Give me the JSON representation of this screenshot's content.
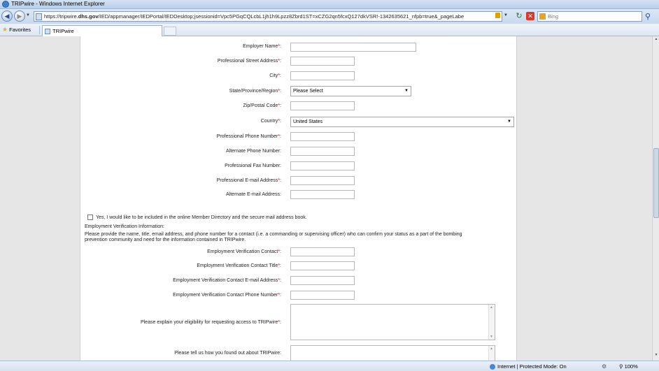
{
  "window": {
    "title": "TRIPwire - Windows Internet Explorer"
  },
  "address_bar": {
    "url_prefix": "https://tripwire.",
    "url_domain": "dhs.gov",
    "url_rest": "/IED/appmanager/IEDPortal/IEDDesktop;jsessionid=Vpc5PGqCQLcbL1jh1h9Lpzz8Zbrd1ST=xCZG2qn5fcxQ127dkVSR!-1342635621_nfpb=true&_pageLabel=USER_REGISTRATION&userAc",
    "search_placeholder": "Bing"
  },
  "favorites_bar": {
    "favorites_label": "Favorites",
    "tab_label": "TRIPwire"
  },
  "form": {
    "employer_name_label": "Employer Name",
    "street_label": "Professional Street Address",
    "city_label": "City",
    "state_label": "State/Province/Region",
    "state_value": "Please Select",
    "zip_label": "Zip/Postal Code",
    "country_label": "Country",
    "country_value": "United States",
    "phone_label": "Professional Phone Number",
    "alt_phone_label": "Alternate Phone Number:",
    "fax_label": "Professional Fax Number:",
    "email_label": "Professional E-mail Address",
    "alt_email_label": "Alternate E-mail Address:",
    "required_mark": "*",
    "colon": ":",
    "directory_checkbox_label": "Yes, I would like to be included in the online Member Directory and the secure mail address book.",
    "verification_heading": "Employment Verification Information:",
    "verification_text_line1": "Please provide the name, title, email address, and phone number for a contact (i.e. a commanding or supervising officer) who can confirm your status as a part of the bombing",
    "verification_text_line2": "prevention community and need for the information contained in TRIPwire.",
    "ev_contact_label": "Employment Verification Contact",
    "ev_title_label": "Employment Verification Contact Title",
    "ev_email_label": "Employment Verification Contact E-mail Address",
    "ev_phone_label": "Employment Verification Contact Phone Number",
    "eligibility_label": "Please explain your eligibility for requesting access to TRIPwire",
    "found_out_label": "Please tell us how you found out about TRIPwire:"
  },
  "status_bar": {
    "zone": "Internet | Protected Mode: On",
    "zoom": "100%"
  }
}
